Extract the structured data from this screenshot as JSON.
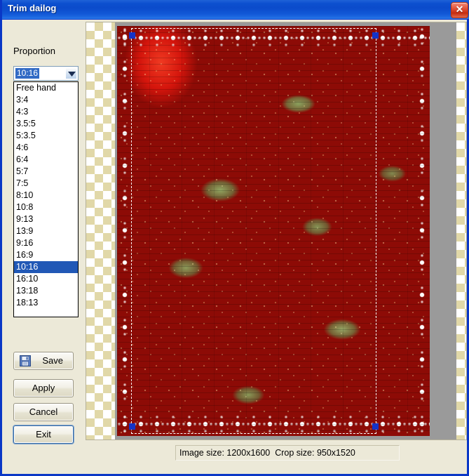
{
  "window": {
    "title": "Trim dailog",
    "close_label": "✕",
    "accent_titlebar": "#0b4bcb",
    "background": "#ece9d8"
  },
  "left_panel": {
    "proportion_label": "Proportion",
    "combo": {
      "name": "proportion-combo",
      "selected_value": "10:16",
      "arrow_icon": "chevron-down-icon"
    },
    "listbox": {
      "selected_index": 15,
      "items": [
        "Free hand",
        "3:4",
        "4:3",
        "3.5:5",
        "5:3.5",
        "4:6",
        "6:4",
        "5:7",
        "7:5",
        "8:10",
        "10:8",
        "9:13",
        "13:9",
        "9:16",
        "16:9",
        "10:16",
        "16:10",
        "13:18",
        "18:13"
      ]
    },
    "buttons": {
      "save": "Save",
      "apply": "Apply",
      "cancel": "Cancel",
      "exit": "Exit",
      "save_icon": "floppy-disk-icon",
      "focused": "Exit"
    }
  },
  "preview": {
    "image_subject": "strawberries",
    "crop": {
      "handle_color": "#1433c8",
      "border_style": "white-dashed"
    }
  },
  "status": {
    "text": "Image size: 1200x1600  Crop size: 950x1520",
    "image_size": "1200x1600",
    "crop_size": "950x1520"
  }
}
